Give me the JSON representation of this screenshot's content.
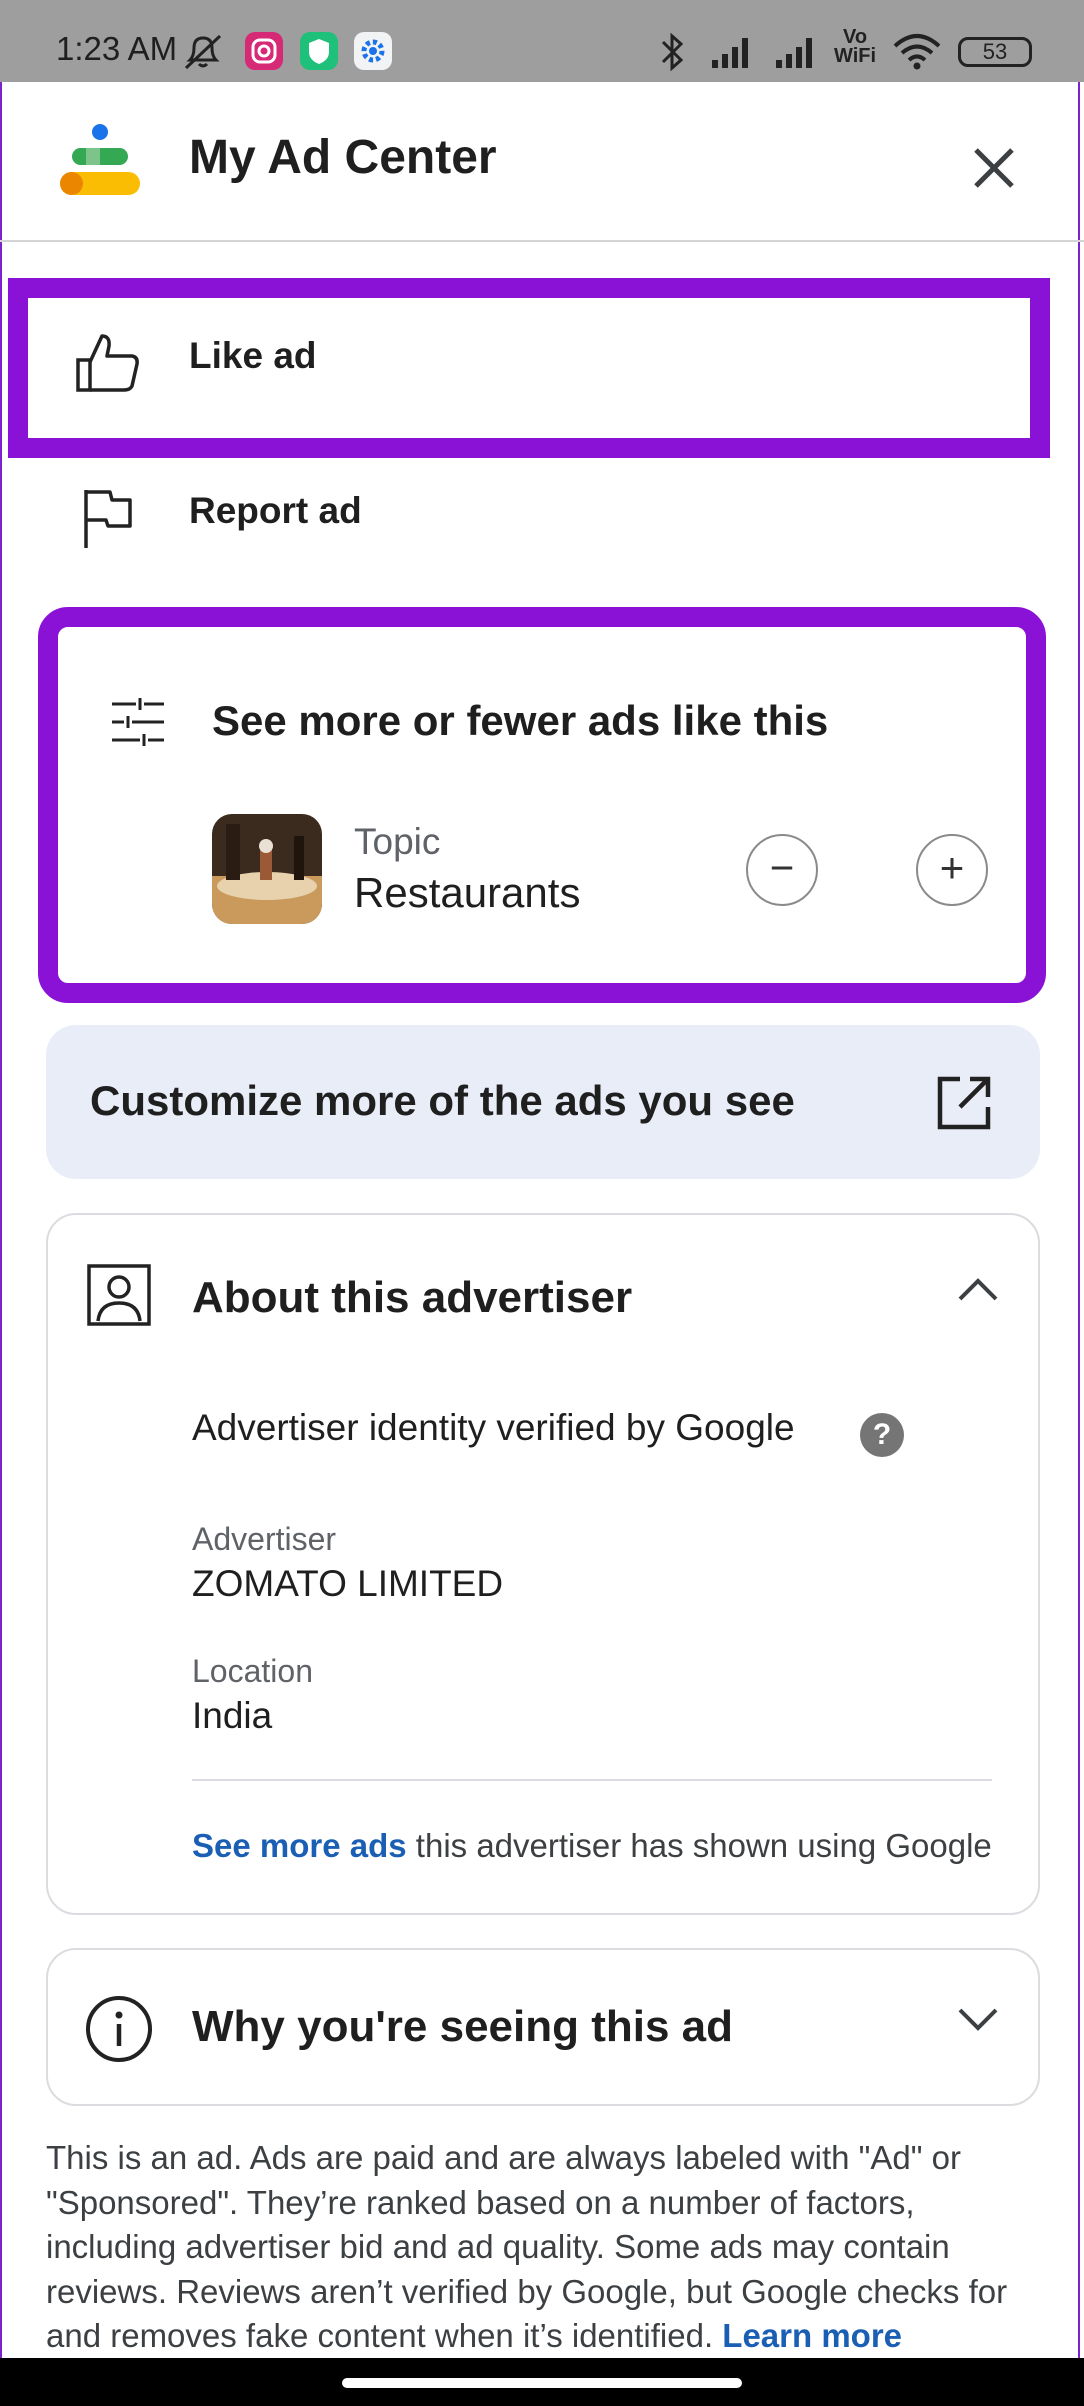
{
  "status_bar": {
    "time": "1:23 AM",
    "battery": "53",
    "vowifi_top": "Vo",
    "vowifi_bottom": "WiFi"
  },
  "header": {
    "title": "My Ad Center"
  },
  "menu": {
    "like_label": "Like ad",
    "report_label": "Report ad"
  },
  "topic_card": {
    "heading": "See more or fewer ads like this",
    "topic_label": "Topic",
    "topic_value": "Restaurants",
    "minus_symbol": "−",
    "plus_symbol": "+"
  },
  "customize": {
    "label": "Customize more of the ads you see"
  },
  "about": {
    "title": "About this advertiser",
    "verified_text": "Advertiser identity verified by Google",
    "help_symbol": "?",
    "advertiser_label": "Advertiser",
    "advertiser_value": "ZOMATO LIMITED",
    "location_label": "Location",
    "location_value": "India",
    "see_more_link": "See more ads",
    "see_more_rest": " this advertiser has shown using Google"
  },
  "why": {
    "title": "Why you're seeing this ad"
  },
  "disclaimer": {
    "text": "This is an ad. Ads are paid and are always labeled with \"Ad\" or \"Sponsored\". They’re ranked based on a number of factors, including advertiser bid and ad quality. Some ads may contain reviews. Reviews aren’t verified by Google, but Google checks for and removes fake content when it’s identified. ",
    "link": "Learn more"
  },
  "colors": {
    "highlight": "#8a12d6",
    "link": "#1a5fb4",
    "customize_bg": "#e8edf8"
  }
}
